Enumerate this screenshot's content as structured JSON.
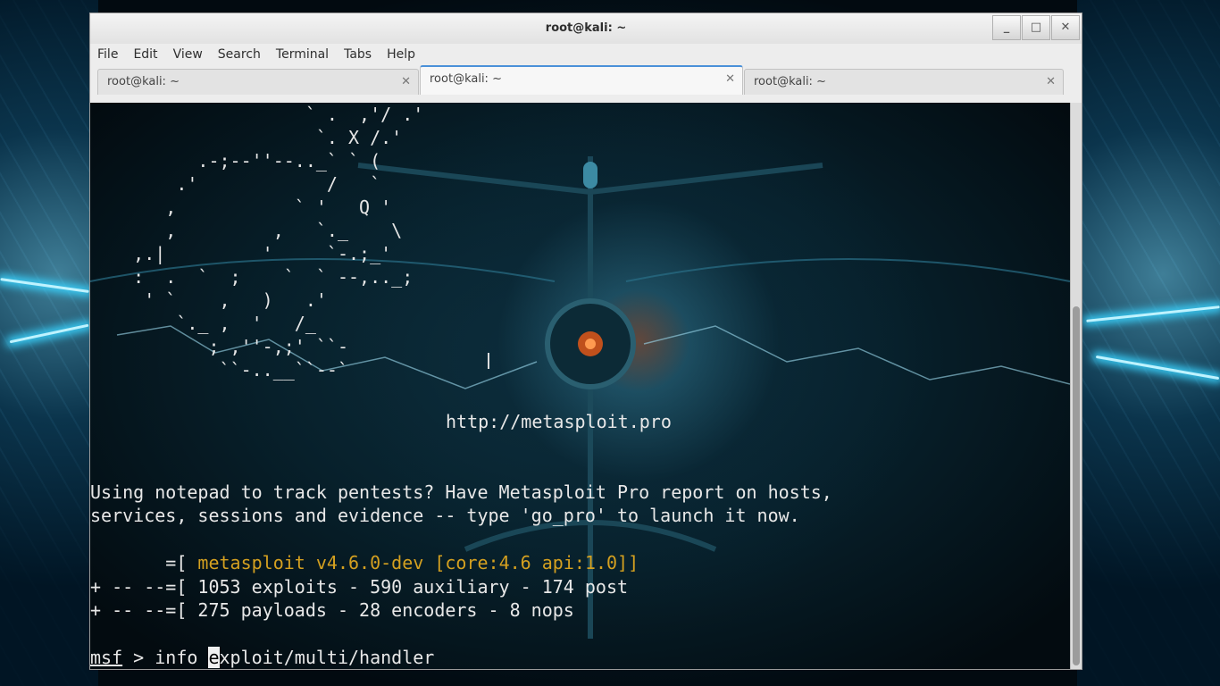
{
  "window": {
    "title": "root@kali: ~",
    "controls": {
      "minimize": "_",
      "maximize": "□",
      "close": "✕"
    }
  },
  "menu": [
    "File",
    "Edit",
    "View",
    "Search",
    "Terminal",
    "Tabs",
    "Help"
  ],
  "tabs": [
    {
      "label": "root@kali: ~",
      "active": false
    },
    {
      "label": "root@kali: ~",
      "active": true
    },
    {
      "label": "root@kali: ~",
      "active": false
    }
  ],
  "terminal": {
    "ascii_art": [
      "                    ` .  ,'/ .'",
      "                     `. X /.'",
      "          .-;--''--.._` ` (",
      "        .'            /   `",
      "       ,           ` '   Q '",
      "       ,         ,   `._    \\",
      "    ,.|         '     `-.;_'",
      "    :  .  `  ;    `  ` --,.._;",
      "     ' `    ,   )   .'",
      "        `._ ,  '   /_",
      "           ; ,''-,;' ``-",
      "            ``-..__``--`"
    ],
    "url": "http://metasploit.pro",
    "banner_line1": "Using notepad to track pentests? Have Metasploit Pro report on hosts,",
    "banner_line2": "services, sessions and evidence -- type 'go_pro' to launch it now.",
    "version_prefix": "       =[ ",
    "version": "metasploit v4.6.0-dev [core:4.6 api:1.0]",
    "stats_line1": "+ -- --=[ 1053 exploits - 590 auxiliary - 174 post",
    "stats_line2": "+ -- --=[ 275 payloads - 28 encoders - 8 nops",
    "prompt_user": "msf",
    "prompt_sep": " > ",
    "command_before_cursor": "info ",
    "cursor_char": "e",
    "command_after_cursor": "xploit/multi/handler"
  }
}
